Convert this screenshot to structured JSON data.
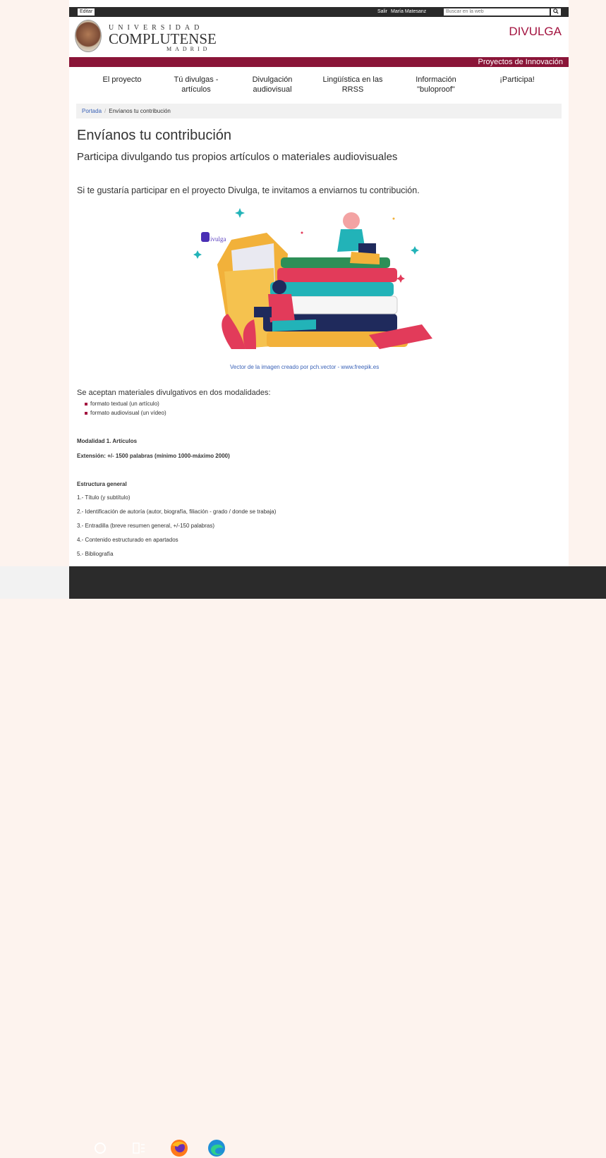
{
  "topbar": {
    "edit_label": "Editar",
    "salir_label": "Salir",
    "user_name": "María Matesanz",
    "search_placeholder": "Buscar en la web",
    "search_button": "Q"
  },
  "logo": {
    "line1": "UNIVERSIDAD",
    "line2": "COMPLUTENSE",
    "line3": "MADRID"
  },
  "brand": "DIVULGA",
  "subbrand": "Proyectos de Innovación",
  "nav": {
    "items": [
      {
        "line1": "El proyecto",
        "line2": ""
      },
      {
        "line1": "Tú divulgas -",
        "line2": "artículos"
      },
      {
        "line1": "Divulgación",
        "line2": "audiovisual"
      },
      {
        "line1": "Lingüística en las",
        "line2": "RRSS"
      },
      {
        "line1": "Información",
        "line2": "\"buloproof\""
      },
      {
        "line1": "¡Participa!",
        "line2": ""
      }
    ]
  },
  "breadcrumb": {
    "home": "Portada",
    "separator": "/",
    "current": "Envíanos tu contribución"
  },
  "page": {
    "title": "Envíanos tu contribución",
    "subtitle": "Participa divulgando tus propios artículos o materiales audiovisuales",
    "intro": "Si te gustaría participar en el proyecto Divulga, te invitamos a enviarnos tu contribución.",
    "image_logo_text": "ivulga",
    "image_credit": "Vector de la imagen creado por pch.vector - www.freepik.es",
    "accept_text": "Se aceptan materiales divulgativos en dos modalidades:",
    "bullets": [
      "formato textual (un artículo)",
      "formato audiovisual (un vídeo)"
    ],
    "modalidad": "Modalidad 1. Artículos",
    "extension": "Extensión: +/- 1500 palabras (mínimo 1000-máximo 2000)",
    "estructura_title": "Estructura general",
    "estructura": [
      "1.- Título (y subtítulo)",
      "2.- Identificación de autoría (autor, biografía, filiación - grado / donde se trabaja)",
      "3.- Entradilla (breve resumen general, +/-150 palabras)",
      "4.- Contenido estructurado en apartados",
      "5.- Bibliografía"
    ]
  },
  "colors": {
    "accent": "#8a1538",
    "link": "#3a62b7",
    "taskbar": "#2b2b2b"
  },
  "taskbar_icons": [
    "search-circle-icon",
    "task-view-icon",
    "firefox-icon",
    "edge-icon"
  ]
}
